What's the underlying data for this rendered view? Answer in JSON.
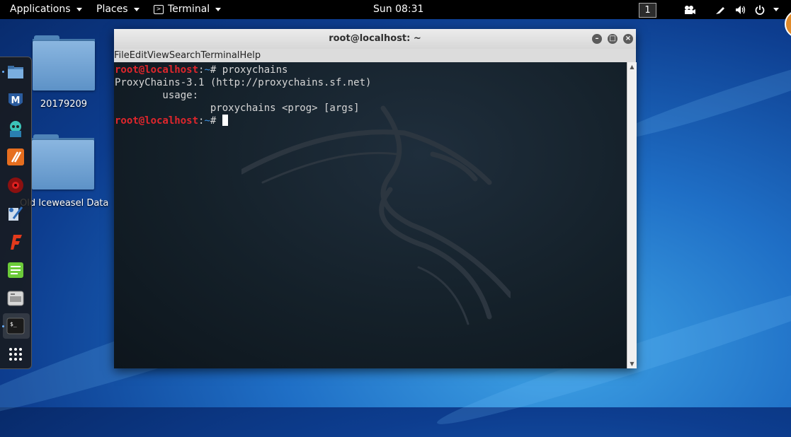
{
  "topbar": {
    "applications": "Applications",
    "places": "Places",
    "terminal_app": "Terminal",
    "clock": "Sun 08:31",
    "workspace": "1"
  },
  "desktop": {
    "icons": [
      {
        "label": "20179209"
      },
      {
        "label": "Old Iceweasel Data"
      }
    ]
  },
  "window": {
    "title": "root@localhost: ~",
    "menu": [
      "File",
      "Edit",
      "View",
      "Search",
      "Terminal",
      "Help"
    ]
  },
  "terminal": {
    "prompt_user": "root@localhost",
    "prompt_tilde": "~",
    "prompt_hash": "# ",
    "prompt_sep": ":",
    "command": "proxychains",
    "out1": "ProxyChains-3.1 (http://proxychains.sf.net)",
    "out2": "        usage:",
    "out3": "                proxychains <prog> [args]"
  },
  "dock": {
    "icons": [
      "files-icon",
      "metasploit-icon",
      "armitage-icon",
      "burpsuite-icon",
      "faraday-icon",
      "maltego-icon",
      "flashfire-icon",
      "notes-icon",
      "keyboard-icon",
      "terminal-icon",
      "show-apps-icon"
    ]
  }
}
